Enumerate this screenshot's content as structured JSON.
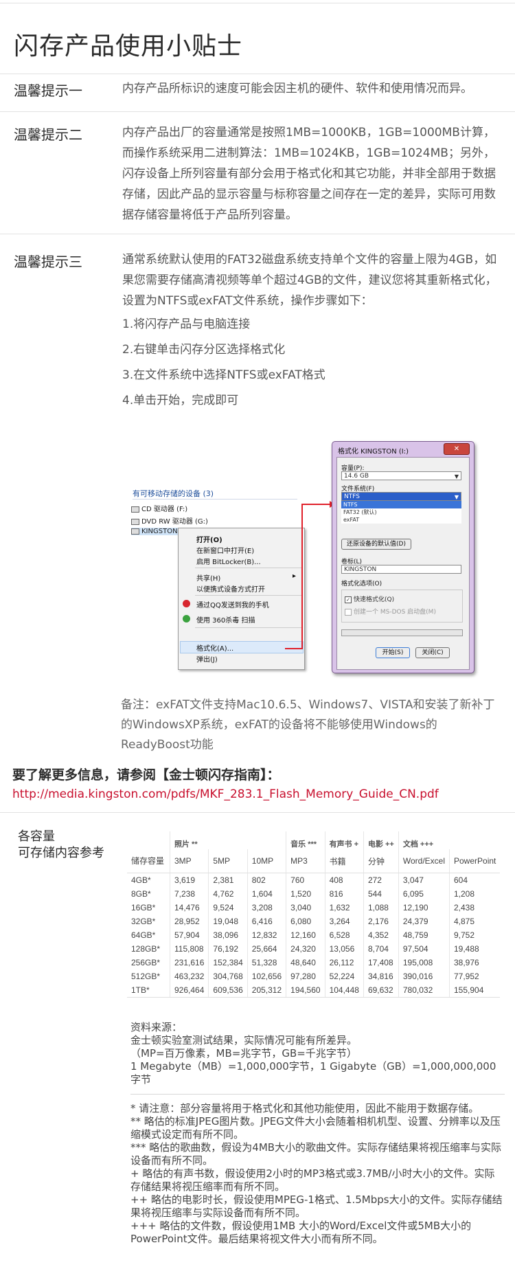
{
  "title": "闪存产品使用小贴士",
  "tips": [
    {
      "label": "温馨提示一",
      "text": "内存产品所标识的速度可能会因主机的硬件、软件和使用情况而异。"
    },
    {
      "label": "温馨提示二",
      "text": "内存产品出厂的容量通常是按照1MB=1000KB，1GB=1000MB计算，而操作系统采用二进制算法：1MB=1024KB，1GB=1024MB；另外，闪存设备上所列容量有部分会用于格式化和其它功能，并非全部用于数据存储，因此产品的显示容量与标称容量之间存在一定的差异，实际可用数据存储容量将低于产品所列容量。"
    },
    {
      "label": "温馨提示三",
      "text": "通常系统默认使用的FAT32磁盘系统支持单个文件的容量上限为4GB，如果您需要存储高清视频等单个超过4GB的文件，建议您将其重新格式化，设置为NTFS或exFAT文件系统，操作步骤如下：",
      "steps": [
        "1.将闪存产品与电脑连接",
        "2.右键单击闪存分区选择格式化",
        "3.在文件系统中选择NTFS或exFAT格式",
        "4.单击开始，完成即可"
      ]
    }
  ],
  "screenshot": {
    "explorer_header": "有可移动存储的设备 (3)",
    "drives": [
      "CD 驱动器 (F:)",
      "DVD RW 驱动器 (G:)",
      "KINGSTON (I:)"
    ],
    "menu": [
      "打开(O)",
      "在新窗口中打开(E)",
      "启用 BitLocker(B)...",
      "共享(H)",
      "以便携式设备方式打开",
      "通过QQ发送到我的手机",
      "使用 360杀毒 扫描",
      "格式化(A)...",
      "弹出(J)"
    ],
    "dialog": {
      "caption": "格式化 KINGSTON (I:)",
      "capacity_label": "容量(P):",
      "capacity_value": "14.6 GB",
      "fs_label": "文件系统(F)",
      "fs_value": "NTFS",
      "fs_options": [
        "NTFS",
        "FAT32 (默认)",
        "exFAT"
      ],
      "restore_button": "还原设备的默认值(D)",
      "volume_label": "卷标(L)",
      "volume_value": "KINGSTON",
      "options_label": "格式化选项(O)",
      "quick_format": "快速格式化(Q)",
      "msdos": "创建一个 MS-DOS 启动盘(M)",
      "start_button": "开始(S)",
      "close_button": "关闭(C)"
    }
  },
  "note": "备注：exFAT文件支持Mac10.6.5、Windows7、VISTA和安装了新补丁的WindowsXP系统，exFAT的设备将不能够使用Windows的ReadyBoost功能",
  "more_info": "要了解更多信息，请参阅【金士顿闪存指南】：",
  "link": "http://media.kingston.com/pdfs/MKF_283.1_Flash_Memory_Guide_CN.pdf",
  "capacity": {
    "title_line1": "各容量",
    "title_line2": "可存储内容参考",
    "groups": [
      "照片 **",
      "音乐 ***",
      "有声书 +",
      "电影 ++",
      "文档 +++"
    ],
    "storage_header": "储存容量",
    "columns": [
      "3MP",
      "5MP",
      "10MP",
      "MP3",
      "书籍",
      "分钟",
      "Word/Excel",
      "PowerPoint"
    ],
    "rows": [
      [
        "4GB*",
        "3,619",
        "2,381",
        "802",
        "760",
        "408",
        "272",
        "3,047",
        "604"
      ],
      [
        "8GB*",
        "7,238",
        "4,762",
        "1,604",
        "1,520",
        "816",
        "544",
        "6,095",
        "1,208"
      ],
      [
        "16GB*",
        "14,476",
        "9,524",
        "3,208",
        "3,040",
        "1,632",
        "1,088",
        "12,190",
        "2,438"
      ],
      [
        "32GB*",
        "28,952",
        "19,048",
        "6,416",
        "6,080",
        "3,264",
        "2,176",
        "24,379",
        "4,875"
      ],
      [
        "64GB*",
        "57,904",
        "38,096",
        "12,832",
        "12,160",
        "6,528",
        "4,352",
        "48,759",
        "9,752"
      ],
      [
        "128GB*",
        "115,808",
        "76,192",
        "25,664",
        "24,320",
        "13,056",
        "8,704",
        "97,504",
        "19,488"
      ],
      [
        "256GB*",
        "231,616",
        "152,384",
        "51,328",
        "48,640",
        "26,112",
        "17,408",
        "195,008",
        "38,976"
      ],
      [
        "512GB*",
        "463,232",
        "304,768",
        "102,656",
        "97,280",
        "52,224",
        "34,816",
        "390,016",
        "77,952"
      ],
      [
        "1TB*",
        "926,464",
        "609,536",
        "205,312",
        "194,560",
        "104,448",
        "69,632",
        "780,032",
        "155,904"
      ]
    ]
  },
  "source": {
    "label": "资料来源：",
    "line1": "金士顿实验室测试结果，实际情况可能有所差异。",
    "line2": "（MP=百万像素，MB=兆字节，GB=千兆字节）",
    "line3": "1 Megabyte（MB）=1,000,000字节，1 Gigabyte（GB）=1,000,000,000字节"
  },
  "footnotes": [
    "* 请注意：部分容量将用于格式化和其他功能使用，因此不能用于数据存储。",
    "** 略估的标准JPEG图片数。JPEG文件大小会随着相机机型、设置、分辨率以及压缩模式设定而有所不同。",
    "*** 略估的歌曲数，假设为4MB大小的歌曲文件。实际存储结果将视压缩率与实际设备而有所不同。",
    "+ 略估的有声书数，假设使用2小时的MP3格式或3.7MB/小时大小的文件。实际存储结果将视压缩率而有所不同。",
    "++ 略估的电影时长，假设使用MPEG-1格式、1.5Mbps大小的文件。实际存储结果将视压缩率与实际设备而有所不同。",
    "+++ 略估的文件数，假设使用1MB 大小的Word/Excel文件或5MB大小的PowerPoint文件。最后结果将视文件大小而有所不同。"
  ],
  "colors": {
    "link": "#c8102e",
    "dialog_frame": "#d9c3e8",
    "arrow": "#e0202a"
  }
}
